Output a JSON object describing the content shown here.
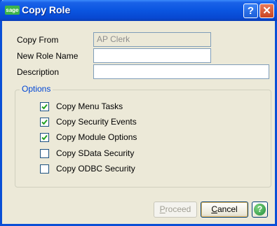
{
  "window": {
    "title": "Copy Role",
    "logo_text": "sage",
    "help_glyph": "?",
    "close_glyph": "✕"
  },
  "form": {
    "copy_from_label": "Copy From",
    "copy_from_value": "AP Clerk",
    "new_role_name_label": "New Role Name",
    "new_role_name_value": "",
    "description_label": "Description",
    "description_value": ""
  },
  "options": {
    "legend": "Options",
    "items": [
      {
        "label": "Copy Menu Tasks",
        "checked": true
      },
      {
        "label": "Copy Security Events",
        "checked": true
      },
      {
        "label": "Copy Module Options",
        "checked": true
      },
      {
        "label": "Copy SData Security",
        "checked": false
      },
      {
        "label": "Copy ODBC Security",
        "checked": false
      }
    ]
  },
  "buttons": {
    "proceed_first": "P",
    "proceed_rest": "roceed",
    "proceed_enabled": false,
    "cancel_first": "C",
    "cancel_rest": "ancel",
    "help_glyph": "?"
  },
  "colors": {
    "title_bar": "#0a55e0",
    "legend": "#0046d5",
    "check": "#21a121",
    "dialog_bg": "#ece9d8"
  }
}
